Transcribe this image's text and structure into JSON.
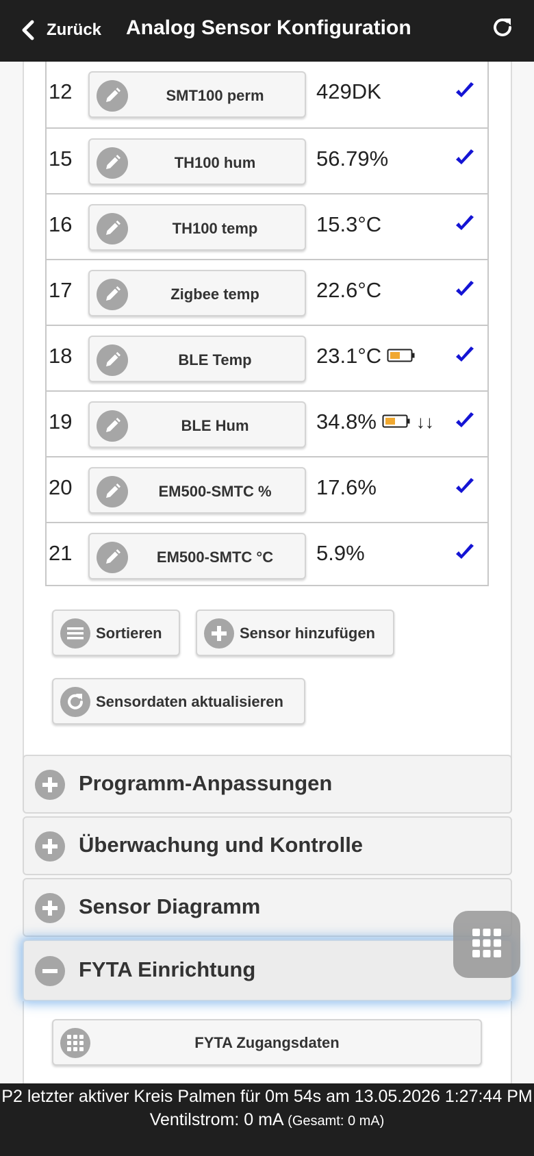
{
  "header": {
    "back_label": "Zurück",
    "title": "Analog Sensor Konfiguration",
    "back_icon": "chevron-left-icon",
    "refresh_icon": "refresh-icon"
  },
  "sensors": [
    {
      "id": "12",
      "name": "SMT100 perm",
      "value": "429DK",
      "battery": false,
      "arrows": ""
    },
    {
      "id": "15",
      "name": "TH100 hum",
      "value": "56.79%",
      "battery": false,
      "arrows": ""
    },
    {
      "id": "16",
      "name": "TH100 temp",
      "value": "15.3°C",
      "battery": false,
      "arrows": ""
    },
    {
      "id": "17",
      "name": "Zigbee temp",
      "value": "22.6°C",
      "battery": false,
      "arrows": ""
    },
    {
      "id": "18",
      "name": "BLE Temp",
      "value": "23.1°C",
      "battery": true,
      "arrows": ""
    },
    {
      "id": "19",
      "name": "BLE Hum",
      "value": "34.8%",
      "battery": true,
      "arrows": "↓↓"
    },
    {
      "id": "20",
      "name": "EM500-SMTC %",
      "value": "17.6%",
      "battery": false,
      "arrows": ""
    },
    {
      "id": "21",
      "name": "EM500-SMTC °C",
      "value": "5.9%",
      "battery": false,
      "arrows": ""
    }
  ],
  "actions": {
    "sort_label": "Sortieren",
    "add_label": "Sensor hinzufügen",
    "refresh_label": "Sensordaten aktualisieren"
  },
  "sections": [
    {
      "label": "Programm-Anpassungen",
      "expanded": false
    },
    {
      "label": "Überwachung und Kontrolle",
      "expanded": false
    },
    {
      "label": "Sensor Diagramm",
      "expanded": false
    },
    {
      "label": "FYTA Einrichtung",
      "expanded": true
    }
  ],
  "fyta": {
    "credentials_label": "FYTA Zugangsdaten"
  },
  "footer": {
    "line1": "P2 letzter aktiver Kreis Palmen für 0m 54s am 13.05.2026 1:27:44 PM",
    "line2": "Ventilstrom: 0 mA",
    "line2_small": "(Gesamt: 0 mA)"
  },
  "colors": {
    "header_bg": "#1f1f1f",
    "check": "#1414d4",
    "battery_fill": "#f0a830",
    "icon_circle": "#a6a6a6"
  }
}
